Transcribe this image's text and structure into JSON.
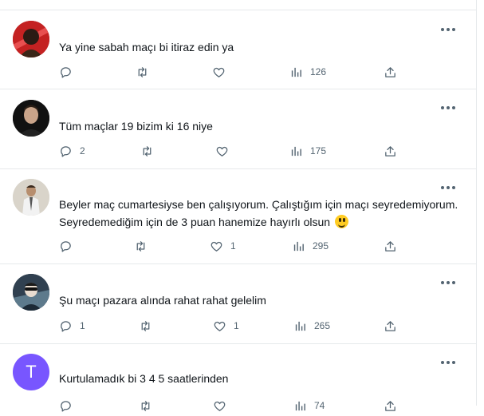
{
  "posts": [
    {
      "text": "Ya yine sabah maçı bi itiraz edin ya",
      "replies": "",
      "retweets": "",
      "likes": "",
      "views": "126"
    },
    {
      "text": "Tüm maçlar 19 bizim ki 16 niye",
      "replies": "2",
      "retweets": "",
      "likes": "",
      "views": "175"
    },
    {
      "text": "Beyler maç cumartesiyse ben çalışıyorum. Çalıştığım için maçı seyredemiyorum. Seyredemediğim için de 3 puan hanemize hayırlı olsun",
      "replies": "",
      "retweets": "",
      "likes": "1",
      "views": "295"
    },
    {
      "text": "Şu maçı pazara alında rahat rahat gelelim",
      "replies": "1",
      "retweets": "",
      "likes": "1",
      "views": "265"
    },
    {
      "text": "Kurtulamadık bi 3 4 5 saatlerinden",
      "avatar_letter": "T",
      "replies": "",
      "retweets": "",
      "likes": "",
      "views": "74"
    }
  ],
  "colors": {
    "icon": "#536471",
    "divider": "#e6e9eb",
    "text": "#0f1419",
    "avatar_purple": "#7856ff"
  },
  "icons": [
    "reply-icon",
    "retweet-icon",
    "like-icon",
    "views-icon",
    "share-icon",
    "more-icon"
  ]
}
